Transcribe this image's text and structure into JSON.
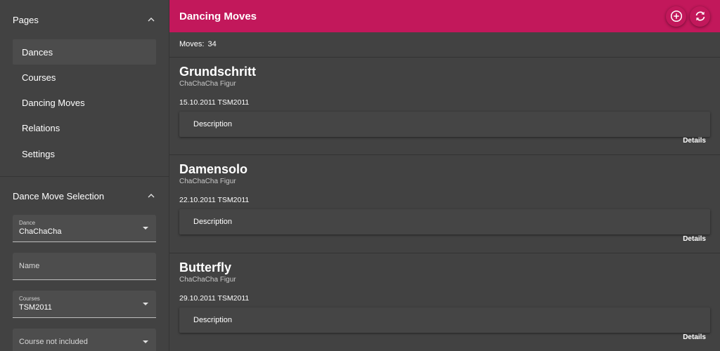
{
  "sidebar": {
    "pages_header": "Pages",
    "pages": [
      {
        "label": "Dances",
        "active": true
      },
      {
        "label": "Courses",
        "active": false
      },
      {
        "label": "Dancing Moves",
        "active": false
      },
      {
        "label": "Relations",
        "active": false
      },
      {
        "label": "Settings",
        "active": false
      }
    ],
    "selection_header": "Dance Move Selection",
    "fields": {
      "dance": {
        "label": "Dance",
        "value": "ChaChaCha"
      },
      "name": {
        "placeholder": "Name"
      },
      "courses": {
        "label": "Courses",
        "value": "TSM2011"
      },
      "course_filter": {
        "value": "Course not included"
      }
    }
  },
  "topbar": {
    "title": "Dancing Moves",
    "color": "#c2185b"
  },
  "count": {
    "label": "Moves:",
    "value": "34"
  },
  "moves": [
    {
      "title": "Grundschritt",
      "subtitle": "ChaChaCha Figur",
      "date": "15.10.2011 TSM2011",
      "description": "Description",
      "details": "Details"
    },
    {
      "title": "Damensolo",
      "subtitle": "ChaChaCha Figur",
      "date": "22.10.2011 TSM2011",
      "description": "Description",
      "details": "Details"
    },
    {
      "title": "Butterfly",
      "subtitle": "ChaChaCha Figur",
      "date": "29.10.2011 TSM2011",
      "description": "Description",
      "details": "Details"
    }
  ]
}
